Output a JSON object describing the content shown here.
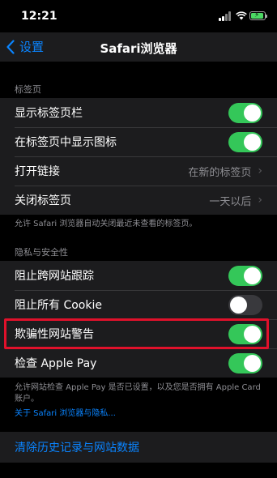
{
  "status": {
    "time": "12:21"
  },
  "nav": {
    "back_label": "设置",
    "title": "Safari浏览器"
  },
  "tabs_section": {
    "header": "标签页",
    "rows": [
      {
        "label": "显示标签页栏",
        "toggle": true
      },
      {
        "label": "在标签页中显示图标",
        "toggle": true
      },
      {
        "label": "打开链接",
        "value": "在新的标签页"
      },
      {
        "label": "关闭标签页",
        "value": "一天以后"
      }
    ],
    "footer": "允许 Safari 浏览器自动关闭最近未查看的标签页。"
  },
  "privacy_section": {
    "header": "隐私与安全性",
    "rows": [
      {
        "label": "阻止跨网站跟踪",
        "toggle": true
      },
      {
        "label": "阻止所有 Cookie",
        "toggle": false
      },
      {
        "label": "欺骗性网站警告",
        "toggle": true
      },
      {
        "label": "检查 Apple Pay",
        "toggle": true
      }
    ],
    "footer": "允许网站检查 Apple Pay 是否已设置，以及您是否拥有 Apple Card 账户。",
    "link": "关于 Safari 浏览器与隐私..."
  },
  "clear": {
    "label": "清除历史记录与网站数据"
  },
  "colors": {
    "accent": "#0a84ff",
    "toggle_on": "#34c759",
    "highlight": "#e0112b"
  }
}
